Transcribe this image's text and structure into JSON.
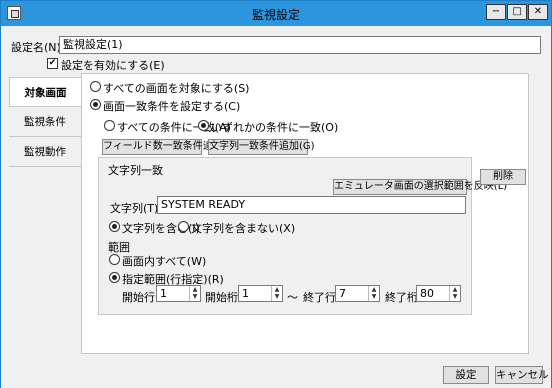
{
  "window": {
    "title": "監視設定",
    "min": "−",
    "max": "□",
    "close": "✕"
  },
  "setting_name": {
    "label": "設定名(N)：",
    "value": "監視設定(1)"
  },
  "enable": {
    "label": "設定を有効にする(E)",
    "checked": true
  },
  "tabs": [
    {
      "label": "対象画面"
    },
    {
      "label": "監視条件"
    },
    {
      "label": "監視動作"
    }
  ],
  "target": {
    "all_screens": "すべての画面を対象にする(S)",
    "match_condition": "画面一致条件を設定する(C)",
    "all_match": "すべての条件に一致(A)",
    "any_match": "いずれかの条件に一致(O)",
    "add_field_btn": "フィールド数一致条件追加(F)",
    "add_string_btn": "文字列一致条件追加(G)"
  },
  "string_match": {
    "group_title": "文字列一致",
    "reflect_btn": "エミュレータ画面の選択範囲を反映(L)",
    "delete_btn": "削除",
    "string_label": "文字列(T)：",
    "string_value": "SYSTEM READY",
    "contains": "文字列を含む(I)",
    "not_contains": "文字列を含まない(X)",
    "range_title": "範囲",
    "whole_screen": "画面内すべて(W)",
    "specified_range": "指定範囲(行指定)(R)",
    "start_row_label": "開始行：",
    "start_row": "1",
    "start_col_label": "開始桁：",
    "start_col": "1",
    "tilde": "～",
    "end_row_label": "終了行：",
    "end_row": "7",
    "end_col_label": "終了桁：",
    "end_col": "80"
  },
  "footer": {
    "ok": "設定",
    "cancel": "キャンセル"
  }
}
